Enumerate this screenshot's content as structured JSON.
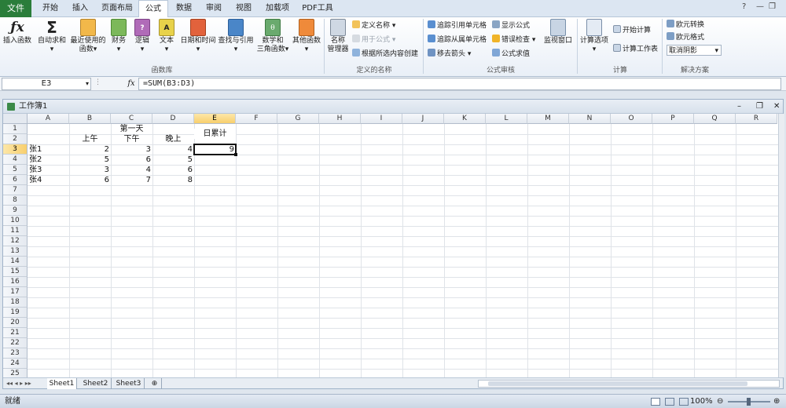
{
  "ribbon_tabs": [
    "文件",
    "开始",
    "插入",
    "页面布局",
    "公式",
    "数据",
    "审阅",
    "视图",
    "加载项",
    "PDF工具"
  ],
  "function_library": {
    "group_name": "函数库",
    "buttons": [
      {
        "label1": "插入函数",
        "label2": "",
        "icon": "fx-icon"
      },
      {
        "label1": "自动求和",
        "label2": "▾",
        "icon": "sigma-icon"
      },
      {
        "label1": "最近使用的",
        "label2": "函数▾",
        "icon": "recent-book-icon"
      },
      {
        "label1": "财务",
        "label2": "▾",
        "icon": "finance-book-icon"
      },
      {
        "label1": "逻辑",
        "label2": "▾",
        "icon": "logic-book-icon"
      },
      {
        "label1": "文本",
        "label2": "▾",
        "icon": "text-book-icon"
      },
      {
        "label1": "日期和时间",
        "label2": "▾",
        "icon": "date-book-icon"
      },
      {
        "label1": "查找与引用",
        "label2": "▾",
        "icon": "lookup-book-icon"
      },
      {
        "label1": "数学和",
        "label2": "三角函数▾",
        "icon": "math-book-icon"
      },
      {
        "label1": "其他函数",
        "label2": "▾",
        "icon": "more-book-icon"
      }
    ]
  },
  "defined_names": {
    "group_name": "定义的名称",
    "manager_label1": "名称",
    "manager_label2": "管理器",
    "items": [
      {
        "label": "定义名称 ▾",
        "disabled": false
      },
      {
        "label": "用于公式 ▾",
        "disabled": true
      },
      {
        "label": "根据所选内容创建",
        "disabled": false
      }
    ]
  },
  "formula_auditing": {
    "group_name": "公式审核",
    "items": [
      "追踪引用单元格",
      "追踪从属单元格",
      "移去箭头 ▾",
      "显示公式",
      "错误检查 ▾",
      "公式求值"
    ],
    "watch_label": "监视窗口"
  },
  "calculation": {
    "group_name": "计算",
    "options_label": "计算选项",
    "items": [
      "开始计算",
      "计算工作表"
    ]
  },
  "solutions": {
    "group_name": "解决方案",
    "items": [
      "欧元转换",
      "欧元格式"
    ],
    "dropdown_value": "取消阴影"
  },
  "formula_bar": {
    "name_box": "E3",
    "fx": "fx",
    "formula": "=SUM(B3:D3)"
  },
  "workbook": {
    "title": "工作簿1",
    "columns": [
      "A",
      "B",
      "C",
      "D",
      "E",
      "F",
      "G",
      "H",
      "I",
      "J",
      "K",
      "L",
      "M",
      "N",
      "O",
      "P",
      "Q",
      "R"
    ],
    "rows": [
      "1",
      "2",
      "3",
      "4",
      "5",
      "6",
      "7",
      "8",
      "9",
      "10",
      "11",
      "12",
      "13",
      "14",
      "15",
      "16",
      "17",
      "18",
      "19",
      "20",
      "21",
      "22",
      "23",
      "24",
      "25"
    ],
    "header_day": "第一天",
    "header_total": "日累计",
    "sub_headers": [
      "上午",
      "下午",
      "晚上"
    ],
    "data_rows": [
      {
        "name": "张1",
        "values": [
          "2",
          "3",
          "4"
        ],
        "total": "9"
      },
      {
        "name": "张2",
        "values": [
          "5",
          "6",
          "5"
        ],
        "total": ""
      },
      {
        "name": "张3",
        "values": [
          "3",
          "4",
          "6"
        ],
        "total": ""
      },
      {
        "name": "张4",
        "values": [
          "6",
          "7",
          "8"
        ],
        "total": ""
      }
    ],
    "sheets": [
      "Sheet1",
      "Sheet2",
      "Sheet3"
    ]
  },
  "status": {
    "ready": "就绪",
    "zoom": "100%"
  }
}
